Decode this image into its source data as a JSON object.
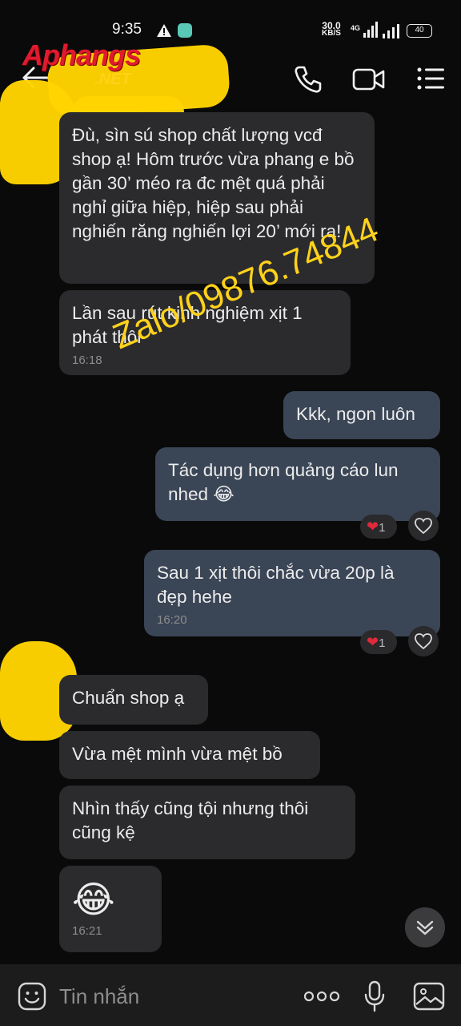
{
  "status_bar": {
    "time": "9:35",
    "net_speed_value": "30.0",
    "net_speed_unit": "KB/S",
    "network": "4G",
    "battery": "40"
  },
  "header": {
    "logo_main": "Aphangs",
    "logo_sub": ".NET"
  },
  "watermark": "Zalo/09876.74844",
  "messages": [
    {
      "id": "m1",
      "side": "in",
      "text": "Đù, sìn sú shop chất lượng vcđ shop ạ! Hôm trước vừa phang e bồ gần 30’ méo ra đc mệt quá phải nghỉ giữa hiệp, hiệp sau phải nghiến răng nghiến lợi 20’ mới ra!"
    },
    {
      "id": "m2",
      "side": "in",
      "text": "Lần sau rút kinh nghiệm xịt 1 phát thôi",
      "time": "16:18"
    },
    {
      "id": "m3",
      "side": "out",
      "text": "Kkk, ngon luôn"
    },
    {
      "id": "m4",
      "side": "out",
      "text": "Tác dụng hơn quảng cáo lun nhed 😂",
      "reaction_count": "1"
    },
    {
      "id": "m5",
      "side": "out",
      "text": "Sau 1 xịt thôi chắc vừa 20p là đẹp hehe",
      "time": "16:20",
      "reaction_count": "1"
    },
    {
      "id": "m6",
      "side": "in",
      "text": "Chuẩn shop ạ"
    },
    {
      "id": "m7",
      "side": "in",
      "text": "Vừa mệt mình vừa mệt bồ"
    },
    {
      "id": "m8",
      "side": "in",
      "text": "Nhìn thấy cũng tội nhưng thôi cũng kệ"
    },
    {
      "id": "m9",
      "side": "in",
      "text": "😂",
      "time": "16:21"
    }
  ],
  "reaction_icon": "❤",
  "input": {
    "placeholder": "Tin nhắn"
  },
  "icons": [
    "back-arrow-icon",
    "phone-icon",
    "video-icon",
    "menu-icon",
    "heart-outline-icon",
    "chevron-down-icon",
    "sticker-icon",
    "more-icon",
    "mic-icon",
    "image-icon"
  ]
}
